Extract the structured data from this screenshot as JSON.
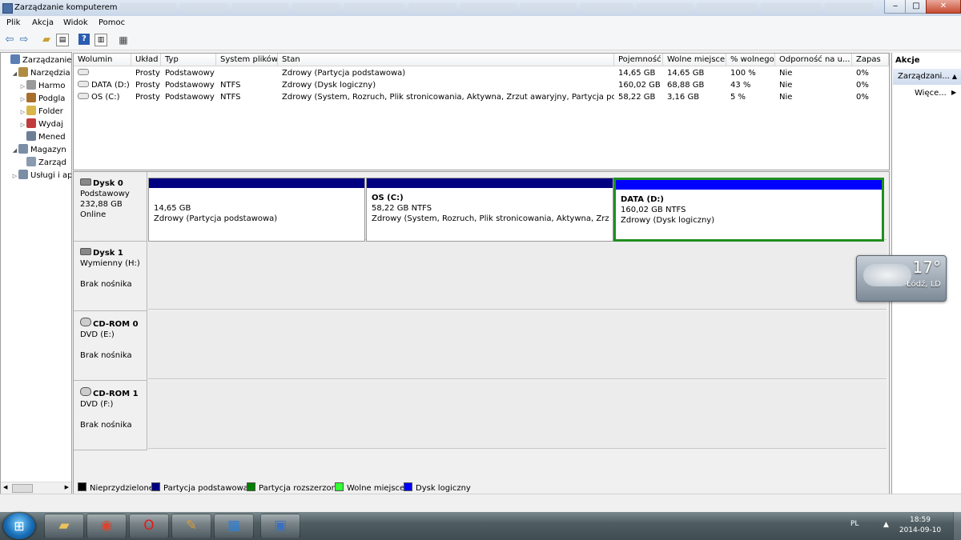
{
  "window": {
    "title": "Zarządzanie komputerem"
  },
  "window_buttons": {
    "minimize": "‒",
    "maximize": "□",
    "close": "✕"
  },
  "menu": [
    "Plik",
    "Akcja",
    "Widok",
    "Pomoc"
  ],
  "toolbar_icons": [
    "back-icon",
    "forward-icon",
    "up-folder-icon",
    "show-hide-tree-icon",
    "help-icon",
    "properties-icon",
    "export-icon"
  ],
  "tree": [
    {
      "label": "Zarządzanie k",
      "indent": 0,
      "expander": "",
      "icon": "computer-icon",
      "color": "#5b7fb3"
    },
    {
      "label": "Narzędzia",
      "indent": 1,
      "expander": "◢",
      "icon": "tools-icon",
      "color": "#b08c42"
    },
    {
      "label": "Harmo",
      "indent": 2,
      "expander": "▷",
      "icon": "clock-icon",
      "color": "#9a9a9a"
    },
    {
      "label": "Podgla",
      "indent": 2,
      "expander": "▷",
      "icon": "event-viewer-icon",
      "color": "#a86e2d"
    },
    {
      "label": "Folder",
      "indent": 2,
      "expander": "▷",
      "icon": "shared-folder-icon",
      "color": "#d9b64a"
    },
    {
      "label": "Wydaj",
      "indent": 2,
      "expander": "▷",
      "icon": "performance-icon",
      "color": "#c23b3b"
    },
    {
      "label": "Mened",
      "indent": 2,
      "expander": "",
      "icon": "device-manager-icon",
      "color": "#6d7f96"
    },
    {
      "label": "Magazyn",
      "indent": 1,
      "expander": "◢",
      "icon": "storage-icon",
      "color": "#7b8ea6"
    },
    {
      "label": "Zarząd",
      "indent": 2,
      "expander": "",
      "icon": "disk-management-icon",
      "color": "#8a9aaf"
    },
    {
      "label": "Usługi i ap",
      "indent": 1,
      "expander": "▷",
      "icon": "services-icon",
      "color": "#7b8ea6"
    }
  ],
  "volume_table": {
    "columns": [
      "Wolumin",
      "Układ",
      "Typ",
      "System plików",
      "Stan",
      "Pojemność",
      "Wolne miejsce",
      "% wolnego",
      "Odporność na u...",
      "Zapas"
    ],
    "rows": [
      [
        "",
        "Prosty",
        "Podstawowy",
        "",
        "Zdrowy (Partycja podstawowa)",
        "14,65 GB",
        "14,65 GB",
        "100 %",
        "Nie",
        "0%"
      ],
      [
        "DATA (D:)",
        "Prosty",
        "Podstawowy",
        "NTFS",
        "Zdrowy (Dysk logiczny)",
        "160,02 GB",
        "68,88 GB",
        "43 %",
        "Nie",
        "0%"
      ],
      [
        "OS (C:)",
        "Prosty",
        "Podstawowy",
        "NTFS",
        "Zdrowy (System, Rozruch, Plik stronicowania, Aktywna, Zrzut awaryjny, Partycja podsta...",
        "58,22 GB",
        "3,16 GB",
        "5 %",
        "Nie",
        "0%"
      ]
    ]
  },
  "disks": [
    {
      "name": "Dysk 0",
      "type": "Podstawowy",
      "size": "232,88 GB",
      "status": "Online",
      "icon": "hard-disk-icon",
      "partitions": [
        {
          "title": "",
          "size": "14,65 GB",
          "state": "Zdrowy (Partycja podstawowa)",
          "bar": "#000080",
          "selected": false
        },
        {
          "title": "OS  (C:)",
          "size": "58,22 GB NTFS",
          "state": "Zdrowy (System, Rozruch, Plik stronicowania, Aktywna, Zrzut aw",
          "bar": "#000080",
          "selected": false
        },
        {
          "title": "DATA  (D:)",
          "size": "160,02 GB NTFS",
          "state": "Zdrowy (Dysk logiczny)",
          "bar": "#0000ff",
          "selected": true
        }
      ]
    },
    {
      "name": "Dysk 1",
      "type": "Wymienny (H:)",
      "size": "",
      "status": "Brak nośnika",
      "icon": "removable-disk-icon",
      "partitions": []
    },
    {
      "name": "CD-ROM 0",
      "type": "DVD (E:)",
      "size": "",
      "status": "Brak nośnika",
      "icon": "cd-rom-icon",
      "partitions": []
    },
    {
      "name": "CD-ROM 1",
      "type": "DVD (F:)",
      "size": "",
      "status": "Brak nośnika",
      "icon": "cd-rom-icon",
      "partitions": []
    }
  ],
  "legend": [
    {
      "label": "Nieprzydzielone",
      "color": "#000000"
    },
    {
      "label": "Partycja podstawowa",
      "color": "#000080"
    },
    {
      "label": "Partycja rozszerzona",
      "color": "#008000"
    },
    {
      "label": "Wolne miejsce",
      "color": "#33ff33"
    },
    {
      "label": "Dysk logiczny",
      "color": "#0000ff"
    }
  ],
  "actions": {
    "header": "Akcje",
    "section": "Zarządzani...",
    "more": "Więce..."
  },
  "weather": {
    "temperature": "17°",
    "city": "Łódź, LD"
  },
  "taskbar": {
    "apps": [
      "explorer-icon",
      "chrome-icon",
      "opera-icon",
      "paint-icon",
      "control-panel-icon",
      "computer-management-icon"
    ],
    "language": "PL",
    "time": "18:59",
    "date": "2014-09-10"
  },
  "colors": {
    "selection_border": "#1f8f1f",
    "primary_bar": "#000080",
    "logical_bar": "#0000ff"
  }
}
